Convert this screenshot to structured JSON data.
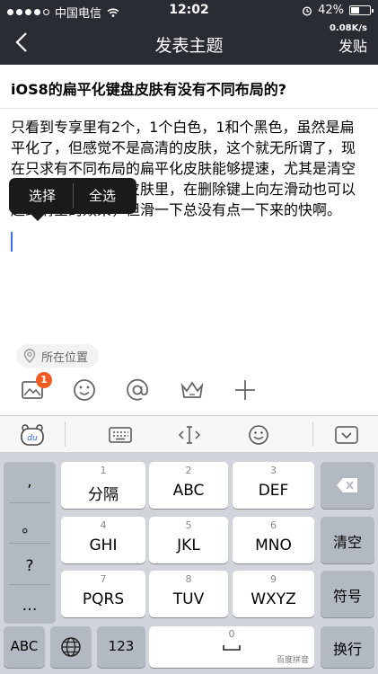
{
  "status": {
    "carrier": "中国电信",
    "time": "12:02",
    "battery": "42%",
    "battery_level": 0.42,
    "speed": "0.08K/s"
  },
  "nav": {
    "title": "发表主题",
    "post_label": "发贴"
  },
  "post": {
    "subject": "iOS8的扁平化键盘皮肤有没有不同布局的?",
    "body": "只看到专享里有2个，1个白色，1和个黑色，虽然是扁平化了，但感觉不是高清的皮肤，这个就无所谓了，现在只求有不同布局的扁平化皮肤能够提速，尤其是清空那个按钮在扁平化皮肤里，在删除键上向左滑动也可以起到清空的效果，但滑一下总没有点一下来的快啊。"
  },
  "popup": {
    "select": "选择",
    "select_all": "全选"
  },
  "location": {
    "label": "所在位置"
  },
  "toolbar": {
    "badge_count": "1"
  },
  "keyboard": {
    "keys": [
      {
        "num": "1",
        "label": "分隔"
      },
      {
        "num": "2",
        "label": "ABC"
      },
      {
        "num": "3",
        "label": "DEF"
      },
      {
        "num": "4",
        "label": "GHI"
      },
      {
        "num": "5",
        "label": "JKL"
      },
      {
        "num": "6",
        "label": "MNO"
      },
      {
        "num": "7",
        "label": "PQRS"
      },
      {
        "num": "8",
        "label": "TUV"
      },
      {
        "num": "9",
        "label": "WXYZ"
      }
    ],
    "side": [
      ",",
      "。",
      "?",
      "…"
    ],
    "clear": "清空",
    "symbols": "符号",
    "abc": "ABC",
    "num123": "123",
    "space_num": "0",
    "space_brand": "百度拼音",
    "enter": "换行"
  }
}
